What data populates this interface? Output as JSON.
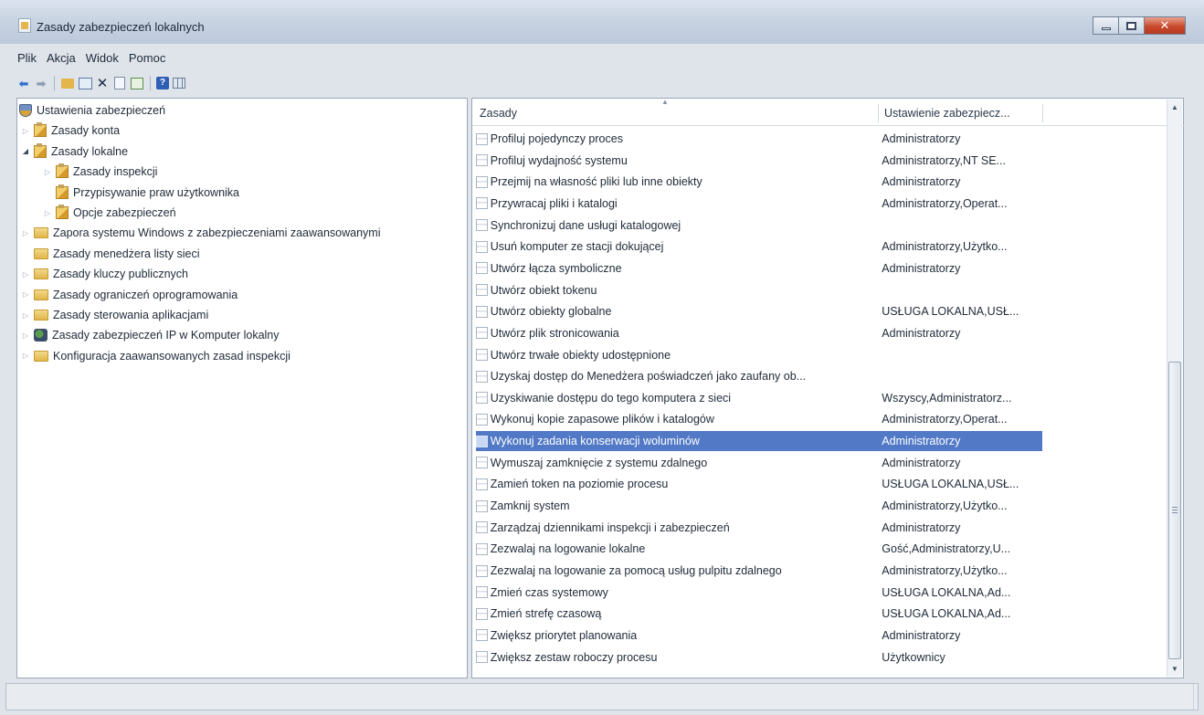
{
  "window": {
    "title": "Zasady zabezpieczeń lokalnych",
    "close_glyph": "✕"
  },
  "menu": {
    "items": [
      "Plik",
      "Akcja",
      "Widok",
      "Pomoc"
    ]
  },
  "toolbar": {
    "icons": [
      "back-icon",
      "forward-icon",
      "folder-up-icon",
      "show-hide-tree-icon",
      "delete-icon",
      "properties-icon",
      "export-list-icon",
      "help-icon",
      "view-grid-icon"
    ],
    "glyphs": {
      "back": "⬅",
      "forward": "➡",
      "delete": "✕",
      "help": "?"
    }
  },
  "tree": {
    "glyphs": {
      "collapsed": "▷",
      "expanded": "◢"
    },
    "items": [
      {
        "label": "Ustawienia zabezpieczeń",
        "icon": "security-settings-icon",
        "level": 0,
        "expander": "none"
      },
      {
        "label": "Zasady konta",
        "icon": "policy-folder-icon",
        "level": 1,
        "expander": "collapsed"
      },
      {
        "label": "Zasady lokalne",
        "icon": "policy-folder-icon",
        "level": 1,
        "expander": "expanded"
      },
      {
        "label": "Zasady inspekcji",
        "icon": "policy-folder-icon",
        "level": 2,
        "expander": "collapsed"
      },
      {
        "label": "Przypisywanie praw użytkownika",
        "icon": "policy-folder-icon",
        "level": 2,
        "expander": "none"
      },
      {
        "label": "Opcje zabezpieczeń",
        "icon": "policy-folder-icon",
        "level": 2,
        "expander": "collapsed"
      },
      {
        "label": "Zapora systemu Windows z zabezpieczeniami zaawansowanymi",
        "icon": "folder-icon",
        "level": 1,
        "expander": "collapsed"
      },
      {
        "label": "Zasady menedżera listy sieci",
        "icon": "folder-icon",
        "level": 1,
        "expander": "none"
      },
      {
        "label": "Zasady kluczy publicznych",
        "icon": "folder-icon",
        "level": 1,
        "expander": "collapsed"
      },
      {
        "label": "Zasady ograniczeń oprogramowania",
        "icon": "folder-icon",
        "level": 1,
        "expander": "collapsed"
      },
      {
        "label": "Zasady sterowania aplikacjami",
        "icon": "folder-icon",
        "level": 1,
        "expander": "collapsed"
      },
      {
        "label": "Zasady zabezpieczeń IP w Komputer lokalny",
        "icon": "ip-security-icon",
        "level": 1,
        "expander": "collapsed"
      },
      {
        "label": "Konfiguracja zaawansowanych zasad inspekcji",
        "icon": "folder-icon",
        "level": 1,
        "expander": "collapsed"
      }
    ]
  },
  "list": {
    "columns": [
      "Zasady",
      "Ustawienie zabezpiecz..."
    ],
    "sort_glyph": "▲",
    "rows": [
      {
        "name": "Profiluj pojedynczy proces",
        "setting": "Administratorzy"
      },
      {
        "name": "Profiluj wydajność systemu",
        "setting": "Administratorzy,NT SE..."
      },
      {
        "name": "Przejmij na własność pliki lub inne obiekty",
        "setting": "Administratorzy"
      },
      {
        "name": "Przywracaj pliki i katalogi",
        "setting": "Administratorzy,Operat..."
      },
      {
        "name": "Synchronizuj dane usługi katalogowej",
        "setting": ""
      },
      {
        "name": "Usuń komputer ze stacji dokującej",
        "setting": "Administratorzy,Użytko..."
      },
      {
        "name": "Utwórz łącza symboliczne",
        "setting": "Administratorzy"
      },
      {
        "name": "Utwórz obiekt tokenu",
        "setting": ""
      },
      {
        "name": "Utwórz obiekty globalne",
        "setting": "USŁUGA LOKALNA,USŁ..."
      },
      {
        "name": "Utwórz plik stronicowania",
        "setting": "Administratorzy"
      },
      {
        "name": "Utwórz trwałe obiekty udostępnione",
        "setting": ""
      },
      {
        "name": "Uzyskaj dostęp do Menedżera poświadczeń jako zaufany ob...",
        "setting": ""
      },
      {
        "name": "Uzyskiwanie dostępu do tego komputera z sieci",
        "setting": "Wszyscy,Administratorz..."
      },
      {
        "name": "Wykonuj kopie zapasowe plików i katalogów",
        "setting": "Administratorzy,Operat..."
      },
      {
        "name": "Wykonuj zadania konserwacji woluminów",
        "setting": "Administratorzy",
        "selected": true
      },
      {
        "name": "Wymuszaj zamknięcie z systemu zdalnego",
        "setting": "Administratorzy"
      },
      {
        "name": "Zamień token na poziomie procesu",
        "setting": "USŁUGA LOKALNA,USŁ..."
      },
      {
        "name": "Zamknij system",
        "setting": "Administratorzy,Użytko..."
      },
      {
        "name": "Zarządzaj dziennikami inspekcji i zabezpieczeń",
        "setting": "Administratorzy"
      },
      {
        "name": "Zezwalaj na logowanie lokalne",
        "setting": "Gość,Administratorzy,U..."
      },
      {
        "name": "Zezwalaj na logowanie za pomocą usług pulpitu zdalnego",
        "setting": "Administratorzy,Użytko..."
      },
      {
        "name": "Zmień czas systemowy",
        "setting": "USŁUGA LOKALNA,Ad..."
      },
      {
        "name": "Zmień strefę czasową",
        "setting": "USŁUGA LOKALNA,Ad..."
      },
      {
        "name": "Zwiększ priorytet planowania",
        "setting": "Administratorzy"
      },
      {
        "name": "Zwiększ zestaw roboczy procesu",
        "setting": "Użytkownicy"
      }
    ]
  },
  "scrollbar": {
    "up_glyph": "▲",
    "down_glyph": "▼",
    "position_fraction": 0.45,
    "visible_fraction": 0.55
  },
  "colors": {
    "selection": "#5179c6",
    "close_button": "#c94a2d"
  }
}
